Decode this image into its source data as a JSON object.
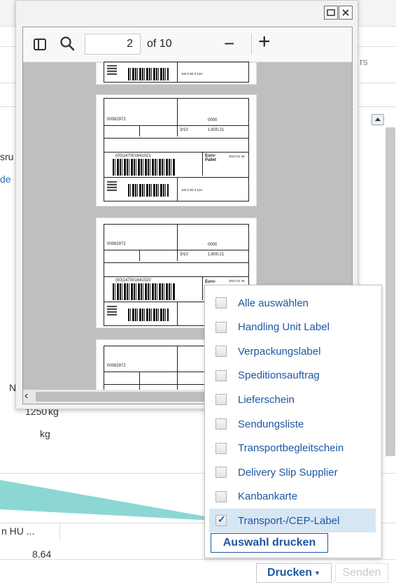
{
  "background": {
    "truncated_texts": {
      "right_top": "rs",
      "left_a": "sru",
      "left_b": "de",
      "left_c": "N",
      "weight_value": "1250",
      "weight_unit": "kg",
      "weight_unit_2": "kg",
      "table_col_header": "n HU ...",
      "table_value": "8.64"
    }
  },
  "pdf_viewer": {
    "current_page": "2",
    "page_count_label": "of 10",
    "zoom_out_label": "−",
    "zoom_in_label": "+",
    "labels": [
      {
        "sscc": "(00)147001641021",
        "pallet": "Euro-\nPallet",
        "date": "2022 01 26",
        "qty": "3/10",
        "weight": "1,600.21",
        "ref": "0000",
        "order": "00082972",
        "pkg_code": "100 0 60 0 120"
      },
      {
        "sscc": "(00)147001641020",
        "pallet": "Euro-",
        "date": "2022 01 26",
        "qty": "3/10",
        "weight": "1,600.21",
        "ref": "0000",
        "order": "00082972"
      },
      {
        "order": "00082972"
      }
    ]
  },
  "print_menu": {
    "items": [
      {
        "label": "Alle auswählen",
        "checked": false,
        "selected": false
      },
      {
        "label": "Handling Unit Label",
        "checked": false,
        "selected": false
      },
      {
        "label": "Verpackungslabel",
        "checked": false,
        "selected": false
      },
      {
        "label": "Speditionsauftrag",
        "checked": false,
        "selected": false
      },
      {
        "label": "Lieferschein",
        "checked": false,
        "selected": false
      },
      {
        "label": "Sendungsliste",
        "checked": false,
        "selected": false
      },
      {
        "label": "Transportbegleitschein",
        "checked": false,
        "selected": false
      },
      {
        "label": "Delivery Slip Supplier",
        "checked": false,
        "selected": false
      },
      {
        "label": "Kanbankarte",
        "checked": false,
        "selected": false
      },
      {
        "label": "Transport-/CEP-Label",
        "checked": true,
        "selected": true
      }
    ],
    "print_selection_label": "Auswahl drucken"
  },
  "footer": {
    "print_button_label": "Drucken",
    "send_button_label": "Senden"
  },
  "colors": {
    "link_blue": "#1d57a4",
    "selected_row": "#d6e6f3",
    "callout_teal": "#7fd3cf"
  }
}
